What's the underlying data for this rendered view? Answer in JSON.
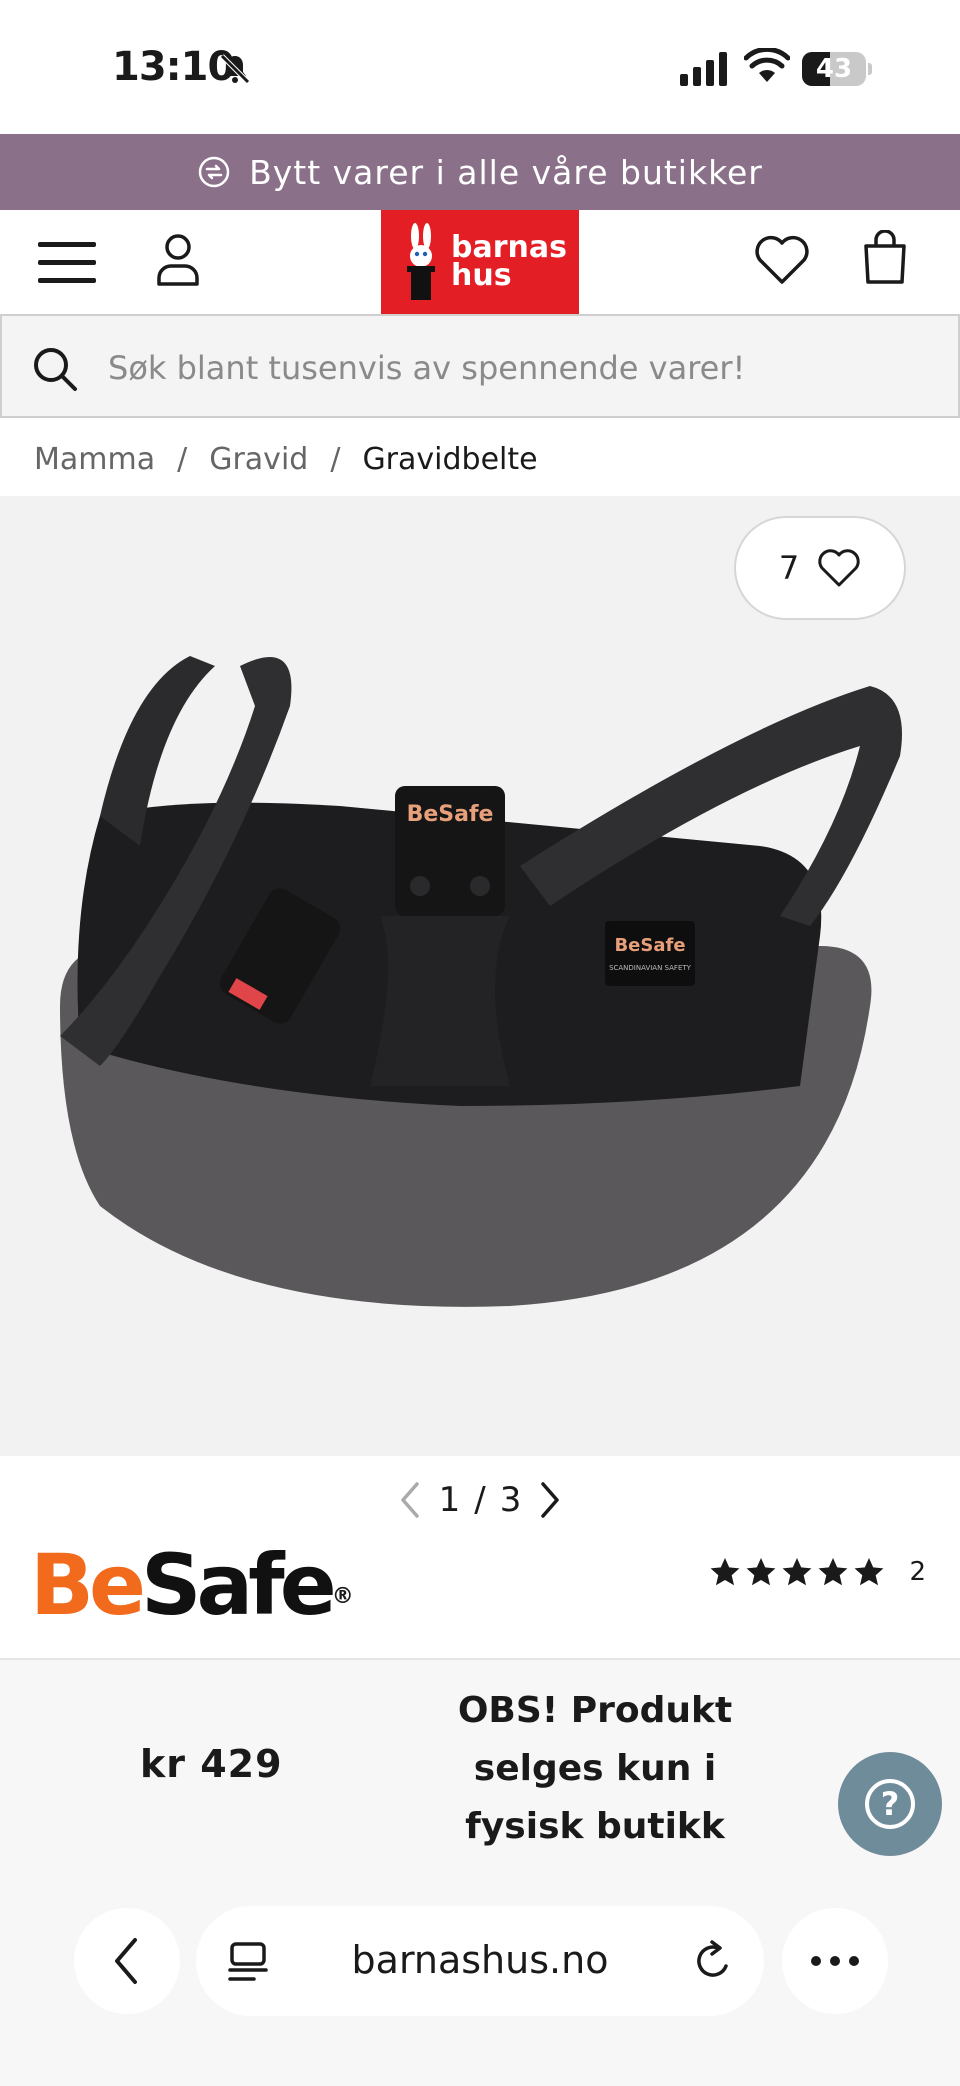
{
  "status_bar": {
    "time": "13:10",
    "battery": "43",
    "battery_level": 0.43
  },
  "promo": {
    "text": "Bytt varer i alle våre butikker",
    "background": "#8a7189"
  },
  "header": {
    "logo_line1": "barnas",
    "logo_line2": "hus",
    "logo_color": "#e31e24"
  },
  "search": {
    "placeholder": "Søk blant tusenvis av spennende varer!"
  },
  "breadcrumb": {
    "items": [
      "Mamma",
      "Gravid",
      "Gravidbelte"
    ],
    "separator": "/"
  },
  "gallery": {
    "favorites_count": "7",
    "current": "1",
    "total": "3",
    "separator": "/"
  },
  "product": {
    "brand_be": "Be",
    "brand_safe": "Safe",
    "brand_reg": "®",
    "rating": 5,
    "review_count": "2",
    "image_brand_label": "BeSafe",
    "image_sub_label": "SCANDINAVIAN SAFETY"
  },
  "buy_bar": {
    "price": "kr 429",
    "notice_line1": "OBS! Produkt",
    "notice_line2": "selges kun i",
    "notice_line3": "fysisk butikk",
    "help_symbol": "?",
    "help_color": "#6f8c9b"
  },
  "browser": {
    "url": "barnashus.no"
  },
  "icons": [
    "bell-slash-icon",
    "signal-icon",
    "wifi-icon",
    "battery-icon",
    "exchange-icon",
    "menu-icon",
    "user-icon",
    "heart-icon",
    "bag-icon",
    "search-icon",
    "chevron-left-icon",
    "chevron-right-icon",
    "star-icon",
    "tabs-icon",
    "reload-icon",
    "more-icon"
  ]
}
